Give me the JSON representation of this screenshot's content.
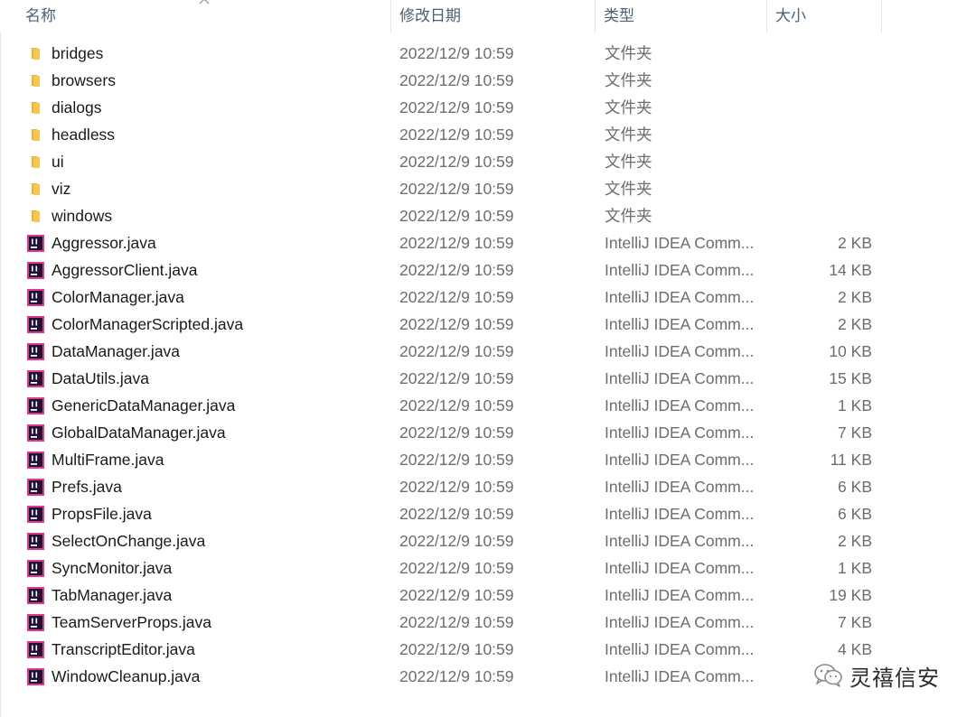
{
  "columns": {
    "name": "名称",
    "date": "修改日期",
    "type": "类型",
    "size": "大小"
  },
  "icons": {
    "folder": "folder-icon",
    "java_file": "intellij-java-file-icon",
    "sort": "sort-up-arrow-icon",
    "watermark": "wechat-icon"
  },
  "colors": {
    "header_text": "#4c607a",
    "name_text": "#1a1a1a",
    "meta_text": "#6d6d6d",
    "folder_yellow": "#f8c64d",
    "java_icon_bg": "#1e1236"
  },
  "files": [
    {
      "name": "bridges",
      "date": "2022/12/9 10:59",
      "type": "文件夹",
      "size": "",
      "kind": "folder"
    },
    {
      "name": "browsers",
      "date": "2022/12/9 10:59",
      "type": "文件夹",
      "size": "",
      "kind": "folder"
    },
    {
      "name": "dialogs",
      "date": "2022/12/9 10:59",
      "type": "文件夹",
      "size": "",
      "kind": "folder"
    },
    {
      "name": "headless",
      "date": "2022/12/9 10:59",
      "type": "文件夹",
      "size": "",
      "kind": "folder"
    },
    {
      "name": "ui",
      "date": "2022/12/9 10:59",
      "type": "文件夹",
      "size": "",
      "kind": "folder"
    },
    {
      "name": "viz",
      "date": "2022/12/9 10:59",
      "type": "文件夹",
      "size": "",
      "kind": "folder"
    },
    {
      "name": "windows",
      "date": "2022/12/9 10:59",
      "type": "文件夹",
      "size": "",
      "kind": "folder"
    },
    {
      "name": "Aggressor.java",
      "date": "2022/12/9 10:59",
      "type": "IntelliJ IDEA Comm...",
      "size": "2 KB",
      "kind": "java"
    },
    {
      "name": "AggressorClient.java",
      "date": "2022/12/9 10:59",
      "type": "IntelliJ IDEA Comm...",
      "size": "14 KB",
      "kind": "java"
    },
    {
      "name": "ColorManager.java",
      "date": "2022/12/9 10:59",
      "type": "IntelliJ IDEA Comm...",
      "size": "2 KB",
      "kind": "java"
    },
    {
      "name": "ColorManagerScripted.java",
      "date": "2022/12/9 10:59",
      "type": "IntelliJ IDEA Comm...",
      "size": "2 KB",
      "kind": "java"
    },
    {
      "name": "DataManager.java",
      "date": "2022/12/9 10:59",
      "type": "IntelliJ IDEA Comm...",
      "size": "10 KB",
      "kind": "java"
    },
    {
      "name": "DataUtils.java",
      "date": "2022/12/9 10:59",
      "type": "IntelliJ IDEA Comm...",
      "size": "15 KB",
      "kind": "java"
    },
    {
      "name": "GenericDataManager.java",
      "date": "2022/12/9 10:59",
      "type": "IntelliJ IDEA Comm...",
      "size": "1 KB",
      "kind": "java"
    },
    {
      "name": "GlobalDataManager.java",
      "date": "2022/12/9 10:59",
      "type": "IntelliJ IDEA Comm...",
      "size": "7 KB",
      "kind": "java"
    },
    {
      "name": "MultiFrame.java",
      "date": "2022/12/9 10:59",
      "type": "IntelliJ IDEA Comm...",
      "size": "11 KB",
      "kind": "java"
    },
    {
      "name": "Prefs.java",
      "date": "2022/12/9 10:59",
      "type": "IntelliJ IDEA Comm...",
      "size": "6 KB",
      "kind": "java"
    },
    {
      "name": "PropsFile.java",
      "date": "2022/12/9 10:59",
      "type": "IntelliJ IDEA Comm...",
      "size": "6 KB",
      "kind": "java"
    },
    {
      "name": "SelectOnChange.java",
      "date": "2022/12/9 10:59",
      "type": "IntelliJ IDEA Comm...",
      "size": "2 KB",
      "kind": "java"
    },
    {
      "name": "SyncMonitor.java",
      "date": "2022/12/9 10:59",
      "type": "IntelliJ IDEA Comm...",
      "size": "1 KB",
      "kind": "java"
    },
    {
      "name": "TabManager.java",
      "date": "2022/12/9 10:59",
      "type": "IntelliJ IDEA Comm...",
      "size": "19 KB",
      "kind": "java"
    },
    {
      "name": "TeamServerProps.java",
      "date": "2022/12/9 10:59",
      "type": "IntelliJ IDEA Comm...",
      "size": "7 KB",
      "kind": "java"
    },
    {
      "name": "TranscriptEditor.java",
      "date": "2022/12/9 10:59",
      "type": "IntelliJ IDEA Comm...",
      "size": "4 KB",
      "kind": "java"
    },
    {
      "name": "WindowCleanup.java",
      "date": "2022/12/9 10:59",
      "type": "IntelliJ IDEA Comm...",
      "size": "",
      "kind": "java"
    }
  ],
  "watermark": {
    "text": "灵禧信安"
  }
}
